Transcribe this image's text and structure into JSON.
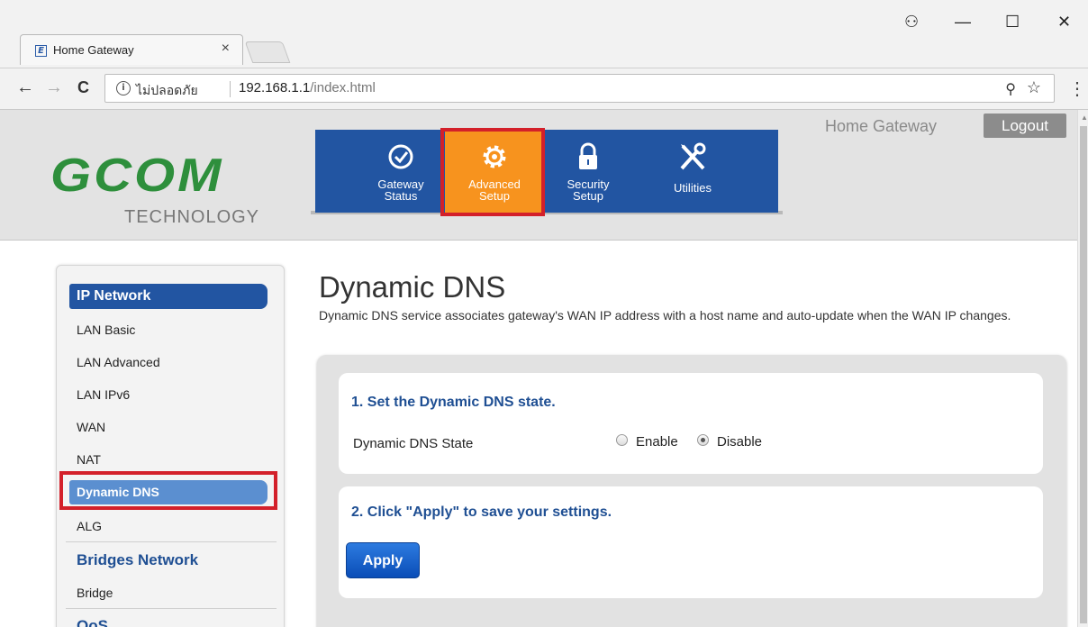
{
  "browser": {
    "tab_title": "Home Gateway",
    "tab_close": "×",
    "security_text": "ไม่ปลอดภัย",
    "url_host": "192.168.1.1",
    "url_path": "/index.html",
    "back": "←",
    "forward": "→",
    "reload": "C",
    "info": "i",
    "key": "⚲",
    "star": "☆",
    "menu": "⋮",
    "window": {
      "account": "⚇",
      "minimize": "—",
      "maximize": "☐",
      "close": "✕"
    }
  },
  "header": {
    "logo_main": "GCOM",
    "logo_sub": "TECHNOLOGY",
    "gateway_title": "Home Gateway",
    "logout": "Logout"
  },
  "nav": {
    "items": [
      {
        "label": "Gateway\nStatus",
        "icon": "check-circle-icon"
      },
      {
        "label": "Advanced\nSetup",
        "icon": "gear-icon",
        "active": true
      },
      {
        "label": "Security\nSetup",
        "icon": "lock-icon"
      },
      {
        "label": "Utilities",
        "icon": "tools-icon"
      }
    ]
  },
  "sidebar": {
    "header": "IP Network",
    "items": [
      "LAN Basic",
      "LAN Advanced",
      "LAN IPv6",
      "WAN",
      "NAT",
      "Dynamic DNS",
      "ALG"
    ],
    "active_item": "Dynamic DNS",
    "groups": [
      "Bridges Network",
      "QoS"
    ],
    "bridge_item": "Bridge"
  },
  "content": {
    "title": "Dynamic DNS",
    "description": "Dynamic DNS service associates gateway's WAN IP address with a host name and auto-update when the WAN IP changes.",
    "section1_title": "1. Set the Dynamic DNS state.",
    "state_label": "Dynamic DNS State",
    "enable_label": "Enable",
    "disable_label": "Disable",
    "selected_state": "Disable",
    "section2_title": "2. Click \"Apply\" to save your settings.",
    "apply": "Apply"
  },
  "colors": {
    "nav_blue": "#2255a2",
    "active_orange": "#f7931e",
    "highlight_red": "#d3202a",
    "logo_green": "#2e8f3c"
  }
}
